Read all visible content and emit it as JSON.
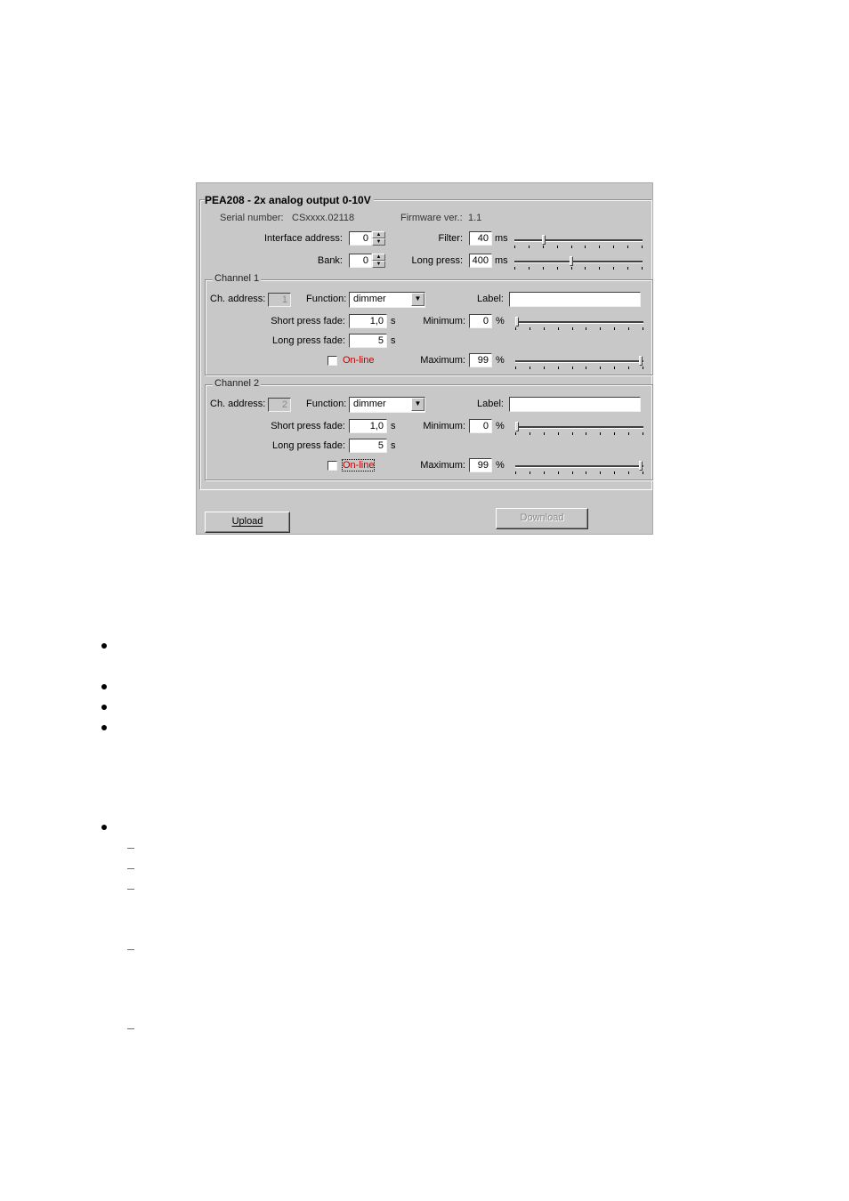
{
  "dialog": {
    "title": "PEA208 - 2x analog output 0-10V",
    "serial_label": "Serial number:",
    "serial_value": "CSxxxx.02118",
    "firmware_label": "Firmware ver.:",
    "firmware_value": "1.1",
    "interface_address_label": "Interface address:",
    "interface_address_value": "0",
    "bank_label": "Bank:",
    "bank_value": "0",
    "filter_label": "Filter:",
    "filter_value": "40",
    "filter_unit": "ms",
    "filter_slider_fraction": 0.22,
    "long_press_label": "Long press:",
    "long_press_value": "400",
    "long_press_unit": "ms",
    "long_press_slider_fraction": 0.44,
    "upload_label": "Upload",
    "download_label": "Download"
  },
  "channels": [
    {
      "group_title": "Channel 1",
      "address_label": "Ch. address:",
      "address_value": "1",
      "function_label": "Function:",
      "function_value": "dimmer",
      "label_label": "Label:",
      "label_value": "",
      "short_fade_label": "Short press fade:",
      "short_fade_value": "1,0",
      "short_fade_unit": "s",
      "long_fade_label": "Long press fade:",
      "long_fade_value": "5",
      "long_fade_unit": "s",
      "online_label": "On-line",
      "online_checked": false,
      "minimum_label": "Minimum:",
      "minimum_value": "0",
      "minimum_unit": "%",
      "minimum_slider_fraction": 0.0,
      "maximum_label": "Maximum:",
      "maximum_value": "99",
      "maximum_unit": "%",
      "maximum_slider_fraction": 0.99
    },
    {
      "group_title": "Channel 2",
      "address_label": "Ch. address:",
      "address_value": "2",
      "function_label": "Function:",
      "function_value": "dimmer",
      "label_label": "Label:",
      "label_value": "",
      "short_fade_label": "Short press fade:",
      "short_fade_value": "1,0",
      "short_fade_unit": "s",
      "long_fade_label": "Long press fade:",
      "long_fade_value": "5",
      "long_fade_unit": "s",
      "online_label": "On-line",
      "online_checked": false,
      "minimum_label": "Minimum:",
      "minimum_value": "0",
      "minimum_unit": "%",
      "minimum_slider_fraction": 0.0,
      "maximum_label": "Maximum:",
      "maximum_value": "99",
      "maximum_unit": "%",
      "maximum_slider_fraction": 0.99
    }
  ],
  "document": {
    "bullets": [
      "",
      "",
      "",
      "",
      ""
    ],
    "sub_dashes": [
      "",
      "",
      "",
      "",
      ""
    ]
  }
}
